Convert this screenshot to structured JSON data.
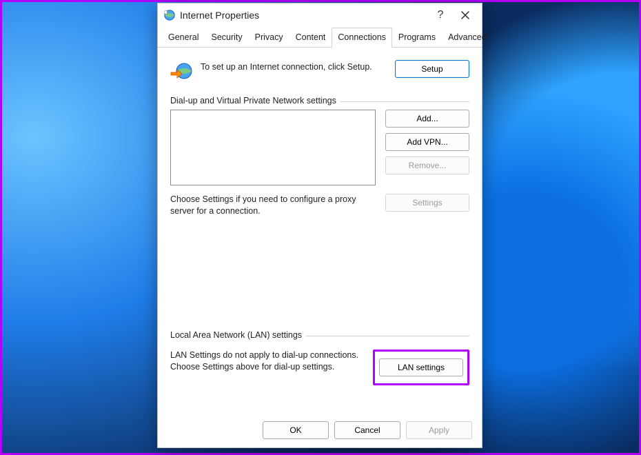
{
  "window": {
    "title": "Internet Properties",
    "help_label": "?",
    "close_label": "✕"
  },
  "tabs": [
    {
      "label": "General",
      "active": false
    },
    {
      "label": "Security",
      "active": false
    },
    {
      "label": "Privacy",
      "active": false
    },
    {
      "label": "Content",
      "active": false
    },
    {
      "label": "Connections",
      "active": true
    },
    {
      "label": "Programs",
      "active": false
    },
    {
      "label": "Advanced",
      "active": false
    }
  ],
  "setup": {
    "text": "To set up an Internet connection, click Setup.",
    "button": "Setup"
  },
  "dialup_group": {
    "label": "Dial-up and Virtual Private Network settings",
    "add_button": "Add...",
    "add_vpn_button": "Add VPN...",
    "remove_button": "Remove...",
    "settings_hint": "Choose Settings if you need to configure a proxy server for a connection.",
    "settings_button": "Settings"
  },
  "lan_group": {
    "label": "Local Area Network (LAN) settings",
    "hint": "LAN Settings do not apply to dial-up connections. Choose Settings above for dial-up settings.",
    "button": "LAN settings"
  },
  "footer": {
    "ok": "OK",
    "cancel": "Cancel",
    "apply": "Apply"
  },
  "highlight": {
    "color": "#b100ff"
  }
}
